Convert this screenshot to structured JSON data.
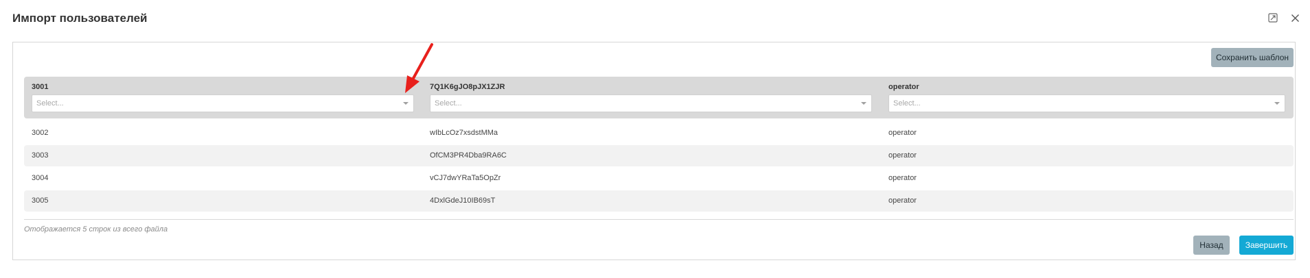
{
  "dialog": {
    "title": "Импорт пользователей",
    "expand_icon": "expand-icon",
    "close_icon": "close-icon"
  },
  "toolbar": {
    "save_template_label": "Сохранить шаблон"
  },
  "mapping": {
    "columns": [
      {
        "header": "3001",
        "placeholder": "Select..."
      },
      {
        "header": "7Q1K6gJO8pJX1ZJR",
        "placeholder": "Select..."
      },
      {
        "header": "operator",
        "placeholder": "Select..."
      }
    ]
  },
  "rows": [
    [
      "3002",
      "wIbLcOz7xsdstMMa",
      "operator"
    ],
    [
      "3003",
      "OfCM3PR4Dba9RA6C",
      "operator"
    ],
    [
      "3004",
      "vCJ7dwYRaTa5OpZr",
      "operator"
    ],
    [
      "3005",
      "4DxlGdeJ10IB69sT",
      "operator"
    ]
  ],
  "footer": {
    "note": "Отображается 5 строк из всего файла",
    "back_label": "Назад",
    "finish_label": "Завершить"
  },
  "colors": {
    "accent": "#14a9d5",
    "secondary_button": "#a2b2ba",
    "annotation_arrow": "#e8201c"
  }
}
